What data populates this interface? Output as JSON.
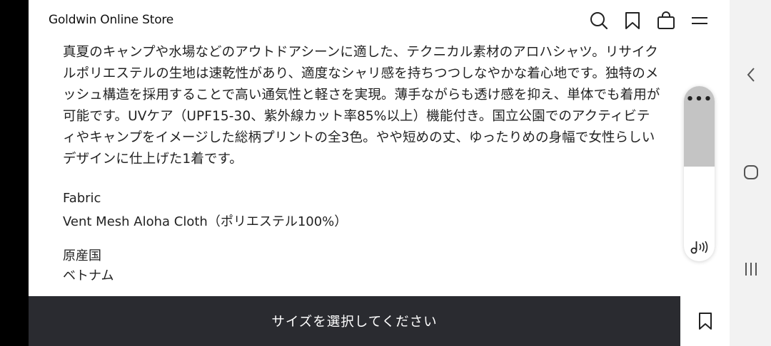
{
  "header": {
    "brand": "Goldwin Online Store",
    "icons": [
      "search-icon",
      "bookmark-icon",
      "shopping-bag-icon",
      "menu-icon"
    ]
  },
  "description": {
    "lines": [
      "真夏のキャンプや水場などのアウトドアシーンに適した、テクニカル素材のアロハシャツ。リサイク",
      "ルポリエステルの生地は速乾性があり、適度なシャリ感を持ちつつしなやかな着心地です。独特のメ",
      "ッシュ構造を採用することで高い通気性と軽さを実現。薄手ながらも透け感を抑え、単体でも着用が",
      "可能です。UVケア（UPF15-30、紫外線カット率85%以上）機能付き。国立公園でのアクティビテ",
      "ィやキャンプをイメージした総柄プリントの全3色。やや短めの丈、ゆったりめの身幅で女性らしい",
      "デザインに仕上げた1着です。"
    ]
  },
  "specs": {
    "fabric_label": "Fabric",
    "fabric_value": "Vent Mesh Aloha Cloth（ポリエステル100%）",
    "origin_label": "原産国",
    "origin_value": "ベトナム"
  },
  "cta": {
    "label": "サイズを選択してください"
  },
  "floating_panel": {
    "more_label": "•••",
    "icons": [
      "more-icon",
      "sound-icon"
    ]
  },
  "system_nav": {
    "icons": [
      "back-icon",
      "home-icon",
      "recents-icon"
    ]
  }
}
